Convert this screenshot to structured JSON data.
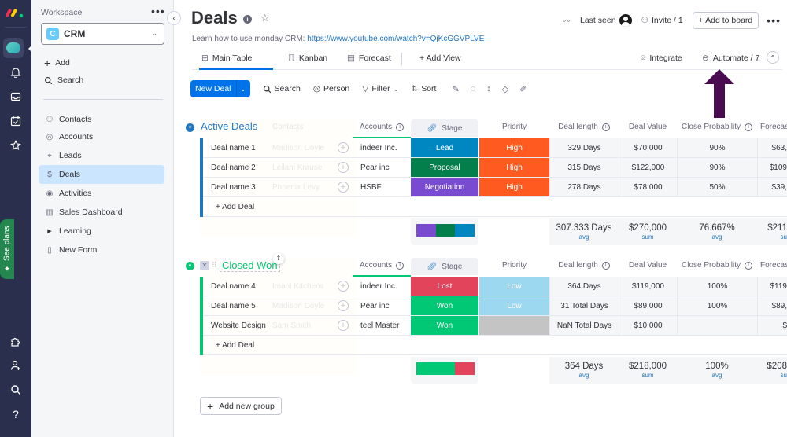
{
  "rail": {
    "icons": [
      "monday-logo",
      "workspace-icon",
      "bell-icon",
      "inbox-icon",
      "calendar-check-icon",
      "star-icon",
      "puzzle-icon",
      "invite-user-icon",
      "search-icon",
      "help-icon"
    ],
    "see_plans": "See plans"
  },
  "workspace": {
    "label": "Workspace",
    "name": "CRM",
    "badge": "C",
    "add": "Add",
    "search": "Search",
    "items": [
      {
        "label": "Contacts",
        "icon": "contacts-icon"
      },
      {
        "label": "Accounts",
        "icon": "accounts-icon"
      },
      {
        "label": "Leads",
        "icon": "leads-icon"
      },
      {
        "label": "Deals",
        "icon": "deals-icon",
        "selected": true
      },
      {
        "label": "Activities",
        "icon": "activities-icon"
      },
      {
        "label": "Sales Dashboard",
        "icon": "dashboard-icon"
      },
      {
        "label": "Learning",
        "icon": "folder-caret-icon"
      },
      {
        "label": "New Form",
        "icon": "form-icon"
      }
    ]
  },
  "board": {
    "title": "Deals",
    "description_prefix": "Learn how to use monday CRM: ",
    "description_link": "https://www.youtube.com/watch?v=QjKcGGVPLVE",
    "last_seen": "Last seen",
    "invite": "Invite / 1",
    "add_to_board": "+ Add to board",
    "more": "•••"
  },
  "tabs": [
    {
      "label": "Main Table",
      "active": true
    },
    {
      "label": "Kanban"
    },
    {
      "label": "Forecast"
    },
    {
      "label": "+ Add View"
    }
  ],
  "tab_actions": {
    "integrate": "Integrate",
    "automate": "Automate / 7"
  },
  "toolbar": {
    "new_deal": "New Deal",
    "search": "Search",
    "person": "Person",
    "filter": "Filter",
    "sort": "Sort"
  },
  "columns": {
    "accounts": "Accounts",
    "stage": "Stage",
    "priority": "Priority",
    "deal_length": "Deal length",
    "deal_value": "Deal Value",
    "close_probability": "Close Probability",
    "forecast": "Forecas"
  },
  "groups": [
    {
      "title": "Active Deals",
      "color": "#1f76c2",
      "ghost_col": "Contacts",
      "rows": [
        {
          "name": "Deal name 1",
          "contact": "Madison Doyle",
          "account": "indeer Inc.",
          "stage": "Lead",
          "stage_color": "#0086c0",
          "priority": "High",
          "priority_color": "#ff5a1f",
          "deal_length": "329 Days",
          "deal_value": "$70,000",
          "close_probability": "90%",
          "forecast": "$63,"
        },
        {
          "name": "Deal name 2",
          "contact": "Leilani Krause",
          "account": "Pear inc",
          "stage": "Proposal",
          "stage_color": "#037f4c",
          "priority": "High",
          "priority_color": "#ff5a1f",
          "deal_length": "315 Days",
          "deal_value": "$122,000",
          "close_probability": "90%",
          "forecast": "$109"
        },
        {
          "name": "Deal name 3",
          "contact": "Phoenix Levy",
          "account": "HSBF",
          "stage": "Negotiation",
          "stage_color": "#784bd1",
          "priority": "High",
          "priority_color": "#ff5a1f",
          "deal_length": "278 Days",
          "deal_value": "$78,000",
          "close_probability": "50%",
          "forecast": "$39,"
        }
      ],
      "add_label": "+ Add Deal",
      "stage_summary": [
        "#784bd1",
        "#037f4c",
        "#0086c0"
      ],
      "summary": {
        "deal_length": {
          "value": "307.333 Days",
          "fn": "avg"
        },
        "deal_value": {
          "value": "$270,000",
          "fn": "sum"
        },
        "close_probability": {
          "value": "76.667%",
          "fn": "avg"
        },
        "forecast": {
          "value": "$211",
          "fn": "su"
        }
      }
    },
    {
      "title": "Closed Won",
      "color": "#00c875",
      "ghost_col": "Contacts",
      "rows": [
        {
          "name": "Deal name 4",
          "contact": "Imani Kitchens",
          "account": "indeer Inc.",
          "stage": "Lost",
          "stage_color": "#e2445c",
          "priority": "Low",
          "priority_color": "#9cd8f0",
          "deal_length": "364 Days",
          "deal_value": "$119,000",
          "close_probability": "100%",
          "forecast": "$119"
        },
        {
          "name": "Deal name 5",
          "contact": "Madison Doyle",
          "account": "Pear inc",
          "stage": "Won",
          "stage_color": "#00c875",
          "priority": "Low",
          "priority_color": "#9cd8f0",
          "deal_length": "31 Total Days",
          "deal_value": "$89,000",
          "close_probability": "100%",
          "forecast": "$89,"
        },
        {
          "name": "Website Design",
          "contact": "Sam Smith",
          "account": "teel Master",
          "stage": "Won",
          "stage_color": "#00c875",
          "priority": "",
          "priority_color": "#c4c4c4",
          "deal_length": "NaN Total Days",
          "deal_value": "$10,000",
          "close_probability": "",
          "forecast": "$"
        }
      ],
      "add_label": "+ Add Deal",
      "stage_summary": [
        "#00c875",
        "#00c875",
        "#e2445c"
      ],
      "summary": {
        "deal_length": {
          "value": "364 Days",
          "fn": "avg"
        },
        "deal_value": {
          "value": "$218,000",
          "fn": "sum"
        },
        "close_probability": {
          "value": "100%",
          "fn": "avg"
        },
        "forecast": {
          "value": "$208",
          "fn": "su"
        }
      }
    }
  ],
  "add_new_group": "Add new group",
  "colors": {
    "accent": "#0073ea",
    "rail": "#292f4c",
    "annotation_arrow": "#4a0a4f"
  }
}
